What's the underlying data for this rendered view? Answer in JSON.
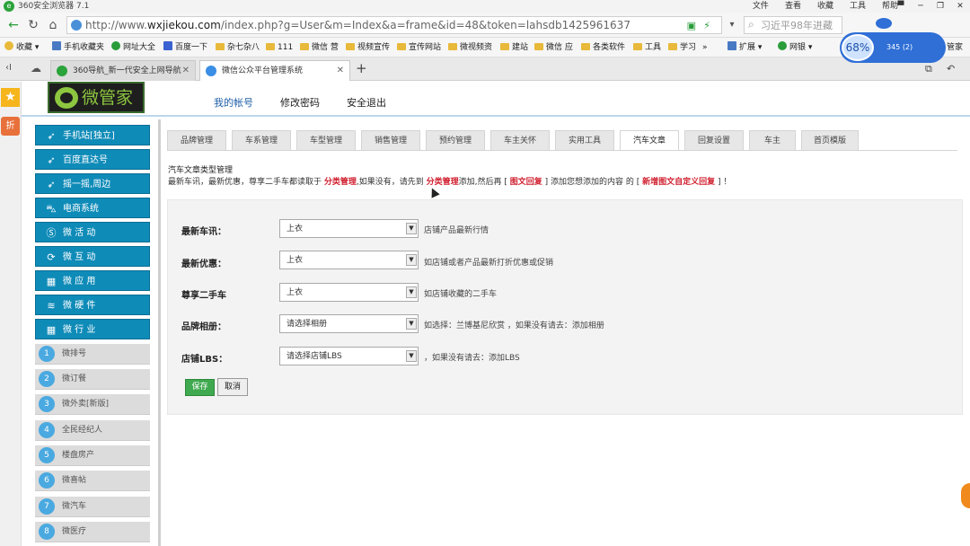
{
  "browser": {
    "title": "360安全浏览器 7.1",
    "menu": [
      "文件",
      "查看",
      "收藏",
      "工具",
      "帮助"
    ],
    "url_prefix": "http://www.",
    "url_domain": "wxjiekou.com",
    "url_path": "/index.php?g=User&m=Index&a=frame&id=48&token=lahsdb1425961637",
    "search_text": "习近平98年进藏",
    "speed_percent": "68%",
    "speed_count": "345 (2)",
    "bookmarks": [
      "收藏",
      "手机收藏夹",
      "网址大全",
      "百度一下",
      "杂七杂八",
      "111",
      "微信 营",
      "视频宣传",
      "宣传网站",
      "微视频资",
      "建站",
      "微信 应",
      "各类软件",
      "工具",
      "学习",
      "»",
      "扩展",
      "网银"
    ],
    "bookmarks_tail": "管家",
    "tabs": [
      "360导航_新一代安全上网导航",
      "微信公众平台管理系统"
    ]
  },
  "site": {
    "logo_text": "微管家",
    "nav": [
      "我的帐号",
      "修改密码",
      "安全退出"
    ]
  },
  "sidebar": {
    "items": [
      {
        "label": "手机站[独立]",
        "icon": "rocket-icon"
      },
      {
        "label": "百度直达号",
        "icon": "rocket-icon"
      },
      {
        "label": "摇一摇,周边",
        "icon": "rocket-icon"
      },
      {
        "label": "电商系统",
        "icon": "cart-icon"
      },
      {
        "label": "微 活 动",
        "icon": "skype-icon"
      },
      {
        "label": "微 互 动",
        "icon": "refresh-icon"
      },
      {
        "label": "微 应 用",
        "icon": "grid-icon"
      },
      {
        "label": "微 硬 件",
        "icon": "wifi-icon"
      },
      {
        "label": "微 行 业",
        "icon": "grid-icon"
      }
    ],
    "sub_items": [
      {
        "num": "1",
        "label": "微排号"
      },
      {
        "num": "2",
        "label": "微订餐"
      },
      {
        "num": "3",
        "label": "微外卖[新版]"
      },
      {
        "num": "4",
        "label": "全民经纪人"
      },
      {
        "num": "5",
        "label": "楼盘房产"
      },
      {
        "num": "6",
        "label": "微喜帖"
      },
      {
        "num": "7",
        "label": "微汽车"
      },
      {
        "num": "8",
        "label": "微医疗"
      }
    ]
  },
  "content": {
    "tabs": [
      "品牌管理",
      "车系管理",
      "车型管理",
      "销售管理",
      "预约管理",
      "车主关怀",
      "实用工具",
      "汽车文章",
      "回复设置",
      "车主",
      "首页模版"
    ],
    "active_tab": "汽车文章",
    "notice_title": "汽车文章类型管理",
    "notice": {
      "p1": "最新车讯，最新优惠，尊享二手车都读取于 ",
      "r1": "分类管理",
      "p2": ",如果没有，请先到 ",
      "r2": "分类管理",
      "p3": "添加,然后再 [ ",
      "r3": "图文回复",
      "p4": " ] 添加您想添加的内容 的 [ ",
      "r4": "新增图文自定义回复",
      "p5": " ] ！"
    },
    "form": [
      {
        "label": "最新车讯：",
        "value": "上衣",
        "hint": "店铺产品最新行情"
      },
      {
        "label": "最新优惠：",
        "value": "上衣",
        "hint": "如店铺或者产品最新打折优惠或促销"
      },
      {
        "label": "尊享二手车",
        "value": "上衣",
        "hint": "如店铺收藏的二手车"
      },
      {
        "label": "品牌相册：",
        "value": "请选择相册",
        "hint": "如选择：兰博基尼欣赏 ，如果没有请去：添加相册"
      },
      {
        "label": "店铺LBS：",
        "value": "请选择店铺LBS",
        "hint": "，如果没有请去：添加LBS"
      }
    ],
    "save_label": "保存",
    "cancel_label": "取消"
  }
}
